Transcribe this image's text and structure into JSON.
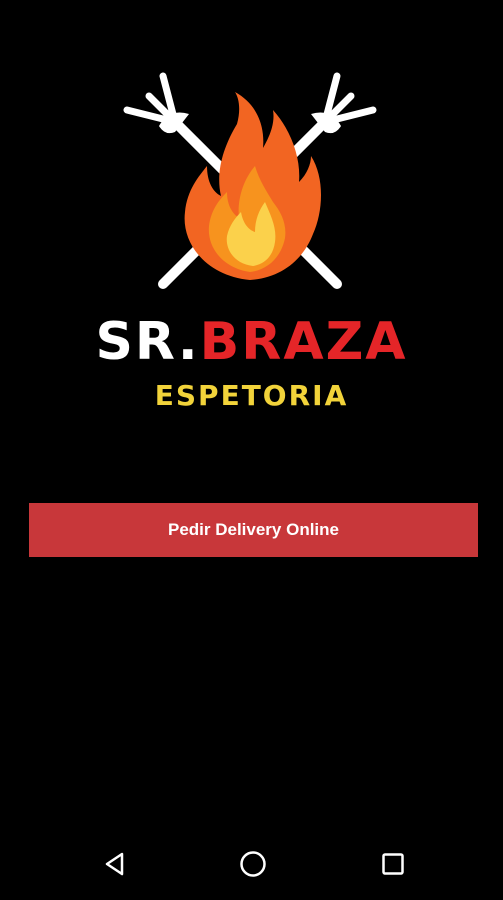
{
  "brand": {
    "name_part1": "SR.",
    "name_part2": "BRAZA",
    "tagline": "ESPETORIA"
  },
  "colors": {
    "background": "#000000",
    "brand_red": "#e52528",
    "tagline_yellow": "#f2d33a",
    "button_red": "#c8373a",
    "fork_white": "#ffffff",
    "flame_orange": "#f26522",
    "flame_yellow": "#fbd14b"
  },
  "actions": {
    "delivery_label": "Pedir Delivery Online"
  },
  "logo": {
    "icons": [
      "fork-icon",
      "fork-icon",
      "flame-icon"
    ]
  },
  "system_nav": {
    "icons": [
      "back-icon",
      "home-icon",
      "recents-icon"
    ]
  }
}
